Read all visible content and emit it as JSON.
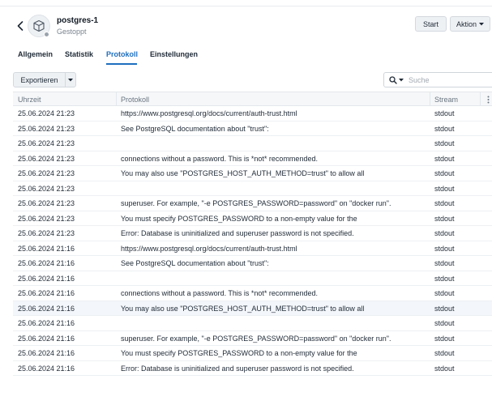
{
  "header": {
    "title": "postgres-1",
    "status": "Gestoppt",
    "start_label": "Start",
    "action_label": "Aktion"
  },
  "tabs": [
    {
      "label": "Allgemein"
    },
    {
      "label": "Statistik"
    },
    {
      "label": "Protokoll"
    },
    {
      "label": "Einstellungen"
    }
  ],
  "active_tab": "Protokoll",
  "toolbar": {
    "export_label": "Exportieren",
    "search_placeholder": "Suche"
  },
  "table": {
    "columns": [
      "Uhrzeit",
      "Protokoll",
      "Stream"
    ],
    "rows": [
      {
        "time": "25.06.2024 21:23",
        "message": "https://www.postgresql.org/docs/current/auth-trust.html",
        "stream": "stdout"
      },
      {
        "time": "25.06.2024 21:23",
        "message": "See PostgreSQL documentation about \"trust\":",
        "stream": "stdout"
      },
      {
        "time": "25.06.2024 21:23",
        "message": "",
        "stream": "stdout"
      },
      {
        "time": "25.06.2024 21:23",
        "message": "connections without a password. This is *not* recommended.",
        "stream": "stdout"
      },
      {
        "time": "25.06.2024 21:23",
        "message": "You may also use \"POSTGRES_HOST_AUTH_METHOD=trust\" to allow all",
        "stream": "stdout"
      },
      {
        "time": "25.06.2024 21:23",
        "message": "",
        "stream": "stdout"
      },
      {
        "time": "25.06.2024 21:23",
        "message": "superuser. For example, \"-e POSTGRES_PASSWORD=password\" on \"docker run\".",
        "stream": "stdout"
      },
      {
        "time": "25.06.2024 21:23",
        "message": "You must specify POSTGRES_PASSWORD to a non-empty value for the",
        "stream": "stdout"
      },
      {
        "time": "25.06.2024 21:23",
        "message": "Error: Database is uninitialized and superuser password is not specified.",
        "stream": "stdout"
      },
      {
        "time": "25.06.2024 21:16",
        "message": "https://www.postgresql.org/docs/current/auth-trust.html",
        "stream": "stdout"
      },
      {
        "time": "25.06.2024 21:16",
        "message": "See PostgreSQL documentation about \"trust\":",
        "stream": "stdout"
      },
      {
        "time": "25.06.2024 21:16",
        "message": "",
        "stream": "stdout"
      },
      {
        "time": "25.06.2024 21:16",
        "message": "connections without a password. This is *not* recommended.",
        "stream": "stdout"
      },
      {
        "time": "25.06.2024 21:16",
        "message": "You may also use \"POSTGRES_HOST_AUTH_METHOD=trust\" to allow all",
        "stream": "stdout",
        "highlighted": true
      },
      {
        "time": "25.06.2024 21:16",
        "message": "",
        "stream": "stdout"
      },
      {
        "time": "25.06.2024 21:16",
        "message": "superuser. For example, \"-e POSTGRES_PASSWORD=password\" on \"docker run\".",
        "stream": "stdout"
      },
      {
        "time": "25.06.2024 21:16",
        "message": "You must specify POSTGRES_PASSWORD to a non-empty value for the",
        "stream": "stdout"
      },
      {
        "time": "25.06.2024 21:16",
        "message": "Error: Database is uninitialized and superuser password is not specified.",
        "stream": "stdout"
      }
    ]
  },
  "icons": {
    "back": "chevron-left-icon",
    "package": "package-icon",
    "aktion_caret": "caret-down-icon",
    "export_caret": "caret-down-icon",
    "search": "search-icon",
    "column_menu": "kebab-menu-icon"
  },
  "colors": {
    "accent": "#1e6fbf",
    "status_dot": "#9aa3ad"
  }
}
